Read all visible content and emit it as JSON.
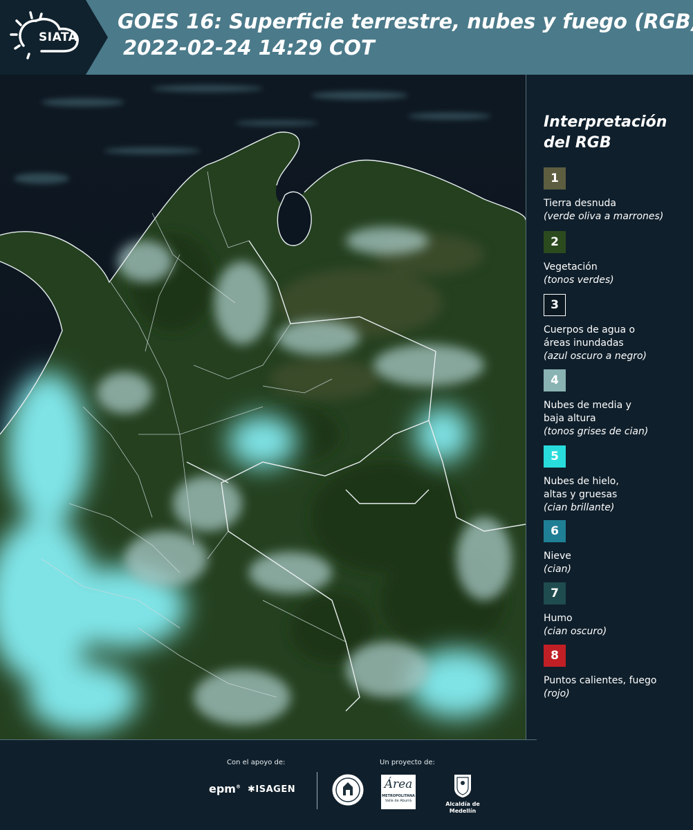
{
  "header": {
    "brand": "SIATA",
    "title_line1": "GOES 16: Superficie terrestre, nubes y fuego (RGB)",
    "title_line2": "2022-02-24 14:29 COT"
  },
  "legend": {
    "title_line1": "Interpretación",
    "title_line2": "del RGB",
    "items": [
      {
        "number": "1",
        "color": "#5d5d40",
        "label_lines": [
          "Tierra desnuda"
        ],
        "sub": "(verde oliva a marrones)"
      },
      {
        "number": "2",
        "color": "#2b4a1e",
        "label_lines": [
          "Vegetación"
        ],
        "sub": "(tonos verdes)"
      },
      {
        "number": "3",
        "color": "#0c1922",
        "label_lines": [
          "Cuerpos de agua o",
          "áreas inundadas"
        ],
        "sub": "(azul oscuro a negro)"
      },
      {
        "number": "4",
        "color": "#8ab3b3",
        "label_lines": [
          "Nubes de media y",
          "baja altura"
        ],
        "sub": "(tonos grises de cian)"
      },
      {
        "number": "5",
        "color": "#29dcdc",
        "label_lines": [
          "Nubes de hielo,",
          "altas y gruesas"
        ],
        "sub": "(cian brillante)"
      },
      {
        "number": "6",
        "color": "#1f7f95",
        "label_lines": [
          "Nieve"
        ],
        "sub": "(cian)"
      },
      {
        "number": "7",
        "color": "#1f4c4f",
        "label_lines": [
          "Humo"
        ],
        "sub": "(cian oscuro)"
      },
      {
        "number": "8",
        "color": "#c01f25",
        "label_lines": [
          "Puntos calientes, fuego"
        ],
        "sub": "(rojo)"
      }
    ]
  },
  "footer": {
    "support_label": "Con el apoyo de:",
    "project_label": "Un proyecto de:",
    "epm": "epm",
    "isagen": "ISAGEN",
    "area_metropolitana": "Área",
    "area_sub1": "METROPOLITANA",
    "area_sub2": "Valle de Aburrá",
    "alcaldia": "Alcaldía de Medellín"
  },
  "colors": {
    "header_bg": "#4b7a8a",
    "logo_panel_bg": "#10222e",
    "page_bg": "#0f1f2b"
  }
}
